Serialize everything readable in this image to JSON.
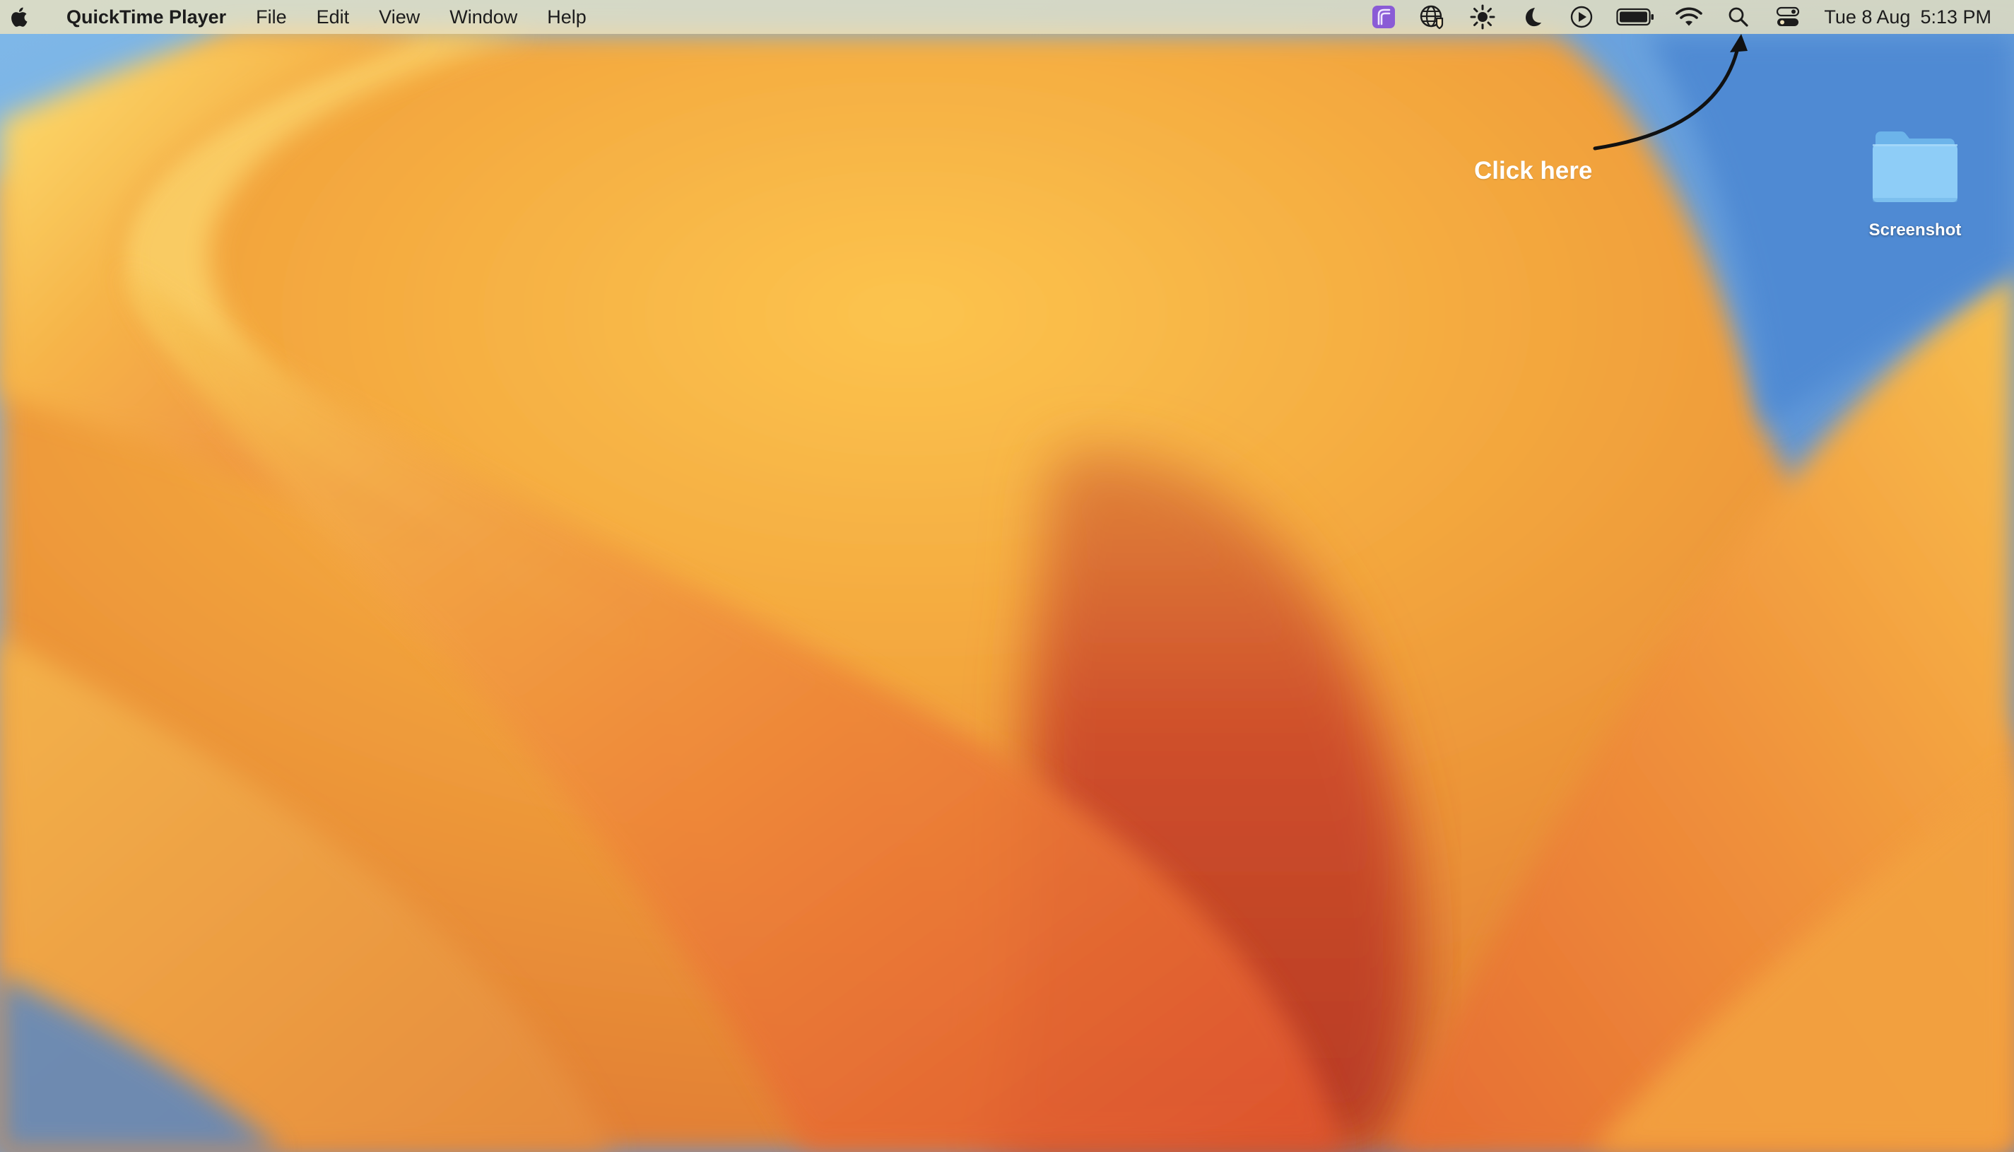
{
  "menubar": {
    "apple_icon": "apple-logo-icon",
    "app_name": "QuickTime Player",
    "items": [
      "File",
      "Edit",
      "View",
      "Window",
      "Help"
    ],
    "status_icons": [
      "app-extension-icon",
      "vpn-globe-icon",
      "brightness-icon",
      "focus-moon-icon",
      "now-playing-icon",
      "battery-icon",
      "wifi-icon",
      "spotlight-search-icon",
      "control-center-icon"
    ],
    "date": "Tue 8 Aug",
    "time": "5:13 PM"
  },
  "annotation": {
    "label": "Click here"
  },
  "desktop": {
    "folder_label": "Screenshot"
  },
  "colors": {
    "menubar_bg": "#f0e4be",
    "wallpaper_orange": "#f0a23a",
    "wallpaper_red": "#c9452a",
    "wallpaper_blue": "#5b9ad8",
    "folder_blue": "#8ecdf7",
    "extension_purple": "#8a5bd6"
  }
}
